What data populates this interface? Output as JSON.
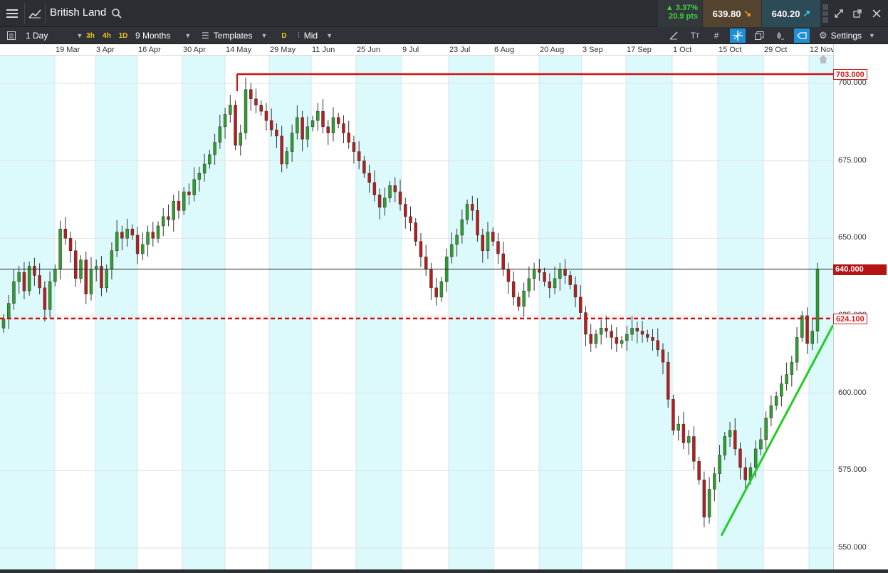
{
  "header": {
    "menu_icon": "hamburger-icon",
    "chart_icon": "line-chart-icon",
    "instrument": "British Land",
    "search_icon": "search-icon",
    "change_pct": "▲ 3.37%",
    "change_pts": "20.9 pts",
    "sell_price": "639.80",
    "buy_price": "640.20"
  },
  "toolbar": {
    "interval": "1 Day",
    "tf_3h": "3h",
    "tf_4h": "4h",
    "tf_1d": "1D",
    "range": "9 Months",
    "templates": "Templates",
    "d_label": "D",
    "price_mode": "Mid",
    "settings": "Settings"
  },
  "colors": {
    "up": "#2e9e2e",
    "down": "#b51e1e",
    "resistance": "#d01010",
    "trend": "#22cc22",
    "band": "#dcfafc"
  },
  "chart_data": {
    "type": "candlestick",
    "instrument": "British Land",
    "interval": "1 Day",
    "x_ticks": [
      "19 Mar",
      "3 Apr",
      "16 Apr",
      "30 Apr",
      "14 May",
      "29 May",
      "11 Jun",
      "25 Jun",
      "9 Jul",
      "23 Jul",
      "6 Aug",
      "20 Aug",
      "3 Sep",
      "17 Sep",
      "1 Oct",
      "15 Oct",
      "29 Oct",
      "12 Nov"
    ],
    "y_ticks": [
      "700.000",
      "675.000",
      "650.000",
      "625.000",
      "600.000",
      "575.000",
      "550.000"
    ],
    "ylim": [
      548,
      705
    ],
    "horizontal_lines": [
      {
        "name": "resistance",
        "value": 703.0,
        "label": "703.000",
        "style": "solid"
      },
      {
        "name": "support",
        "value": 624.1,
        "label": "624.100",
        "style": "dashed"
      },
      {
        "name": "current",
        "value": 640.0,
        "label": "640.000",
        "style": "thin"
      }
    ],
    "trendline": {
      "from": {
        "date": "15 Oct",
        "price": 554
      },
      "to": {
        "date": "12 Nov",
        "price": 614
      }
    },
    "closes": [
      624,
      629,
      636,
      639,
      633,
      641,
      638,
      634,
      627,
      636,
      640,
      653,
      650,
      646,
      637,
      643,
      632,
      640,
      641,
      634,
      640,
      646,
      652,
      650,
      653,
      651,
      645,
      648,
      652,
      650,
      654,
      657,
      656,
      662,
      659,
      665,
      664,
      669,
      671,
      674,
      677,
      681,
      686,
      690,
      693,
      680,
      684,
      698,
      695,
      693,
      691,
      688,
      685,
      683,
      674,
      678,
      684,
      689,
      682,
      686,
      688,
      691,
      686,
      684,
      689,
      687,
      684,
      681,
      678,
      675,
      671,
      668,
      664,
      660,
      663,
      667,
      665,
      661,
      657,
      655,
      649,
      644,
      640,
      634,
      631,
      636,
      644,
      648,
      651,
      656,
      661,
      659,
      651,
      646,
      652,
      649,
      645,
      640,
      636,
      631,
      628,
      633,
      637,
      640,
      639,
      636,
      634,
      637,
      640,
      638,
      635,
      631,
      626,
      619,
      616,
      619,
      621,
      620,
      618,
      616,
      617,
      619,
      621,
      620,
      619,
      618,
      617,
      614,
      610,
      598,
      588,
      590,
      584,
      586,
      578,
      572,
      560,
      569,
      574,
      580,
      586,
      588,
      582,
      576,
      572,
      576,
      582,
      585,
      592,
      596,
      599,
      603,
      606,
      610,
      618,
      625,
      616,
      620,
      640
    ],
    "volume_profile": "none"
  }
}
